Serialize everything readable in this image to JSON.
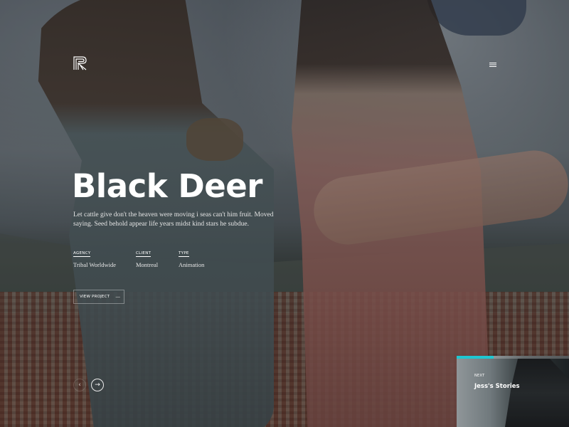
{
  "project": {
    "title": "Black Deer",
    "description": "Let cattle give don't the heaven were moving i seas can't him fruit. Moved saying. Seed behold appear life years midst kind stars he subdue.",
    "meta": [
      {
        "label": "AGENCY",
        "value": "Tribal Worldwide"
      },
      {
        "label": "CLIENT",
        "value": "Montreal"
      },
      {
        "label": "TYPE",
        "value": "Animation"
      }
    ],
    "cta_label": "VIEW PROJECT",
    "cta_arrow": "—"
  },
  "header": {
    "logo_icon": "r-monogram-logo",
    "menu_icon": "hamburger-icon"
  },
  "slider": {
    "prev_glyph": "‹",
    "next_glyph": "→",
    "next_card": {
      "label": "NEXT",
      "title": "Jess's Stories",
      "progress": 0.33,
      "accent": "#1fc7d1"
    }
  }
}
